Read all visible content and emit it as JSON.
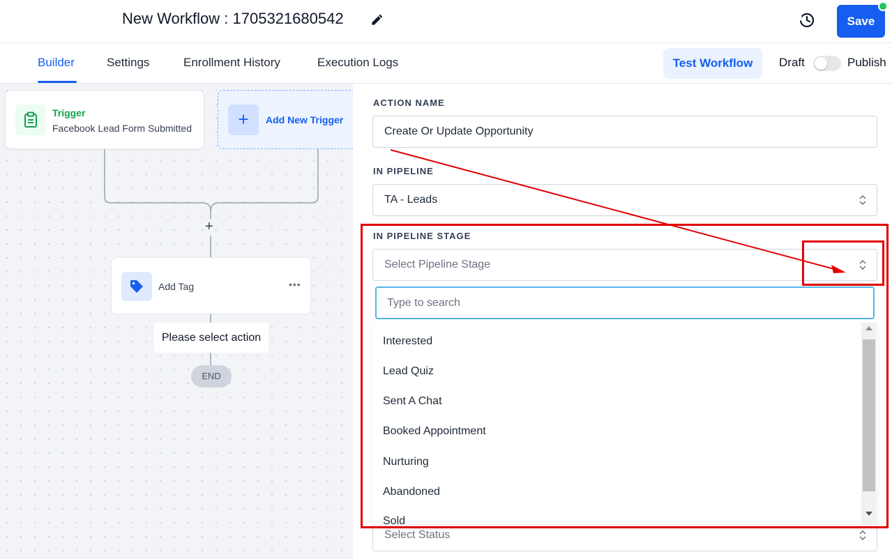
{
  "header": {
    "title": "New Workflow : 1705321680542",
    "save_label": "Save"
  },
  "tabs": [
    {
      "label": "Builder",
      "active": true
    },
    {
      "label": "Settings"
    },
    {
      "label": "Enrollment History"
    },
    {
      "label": "Execution Logs"
    }
  ],
  "toolbar": {
    "test_label": "Test Workflow",
    "draft_label": "Draft",
    "publish_label": "Publish",
    "published": false
  },
  "canvas": {
    "trigger": {
      "title": "Trigger",
      "subtitle": "Facebook Lead Form Submitted"
    },
    "add_trigger_label": "Add New Trigger",
    "action": {
      "label": "Add Tag"
    },
    "warning": "Please select action",
    "end_label": "END"
  },
  "panel": {
    "action_name": {
      "label": "ACTION NAME",
      "value": "Create Or Update Opportunity"
    },
    "pipeline": {
      "label": "IN PIPELINE",
      "value": "TA - Leads"
    },
    "pipeline_stage": {
      "label": "IN PIPELINE STAGE",
      "placeholder": "Select Pipeline Stage",
      "search_placeholder": "Type to search",
      "options": [
        "Interested",
        "Lead Quiz",
        "Sent A Chat",
        "Booked Appointment",
        "Nurturing",
        "Abandoned",
        "Sold"
      ]
    },
    "status": {
      "placeholder": "Select Status"
    }
  },
  "colors": {
    "primary": "#155eef",
    "trigger_green": "#12a150",
    "annotation_red": "#e00000",
    "status_dot": "#22c55e"
  }
}
